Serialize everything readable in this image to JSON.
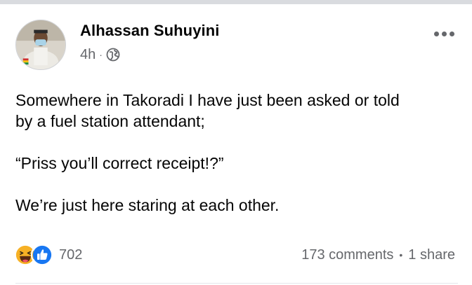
{
  "post": {
    "author": "Alhassan Suhuyini",
    "time": "4h",
    "separator": "·",
    "privacy_icon": "globe-icon",
    "body": {
      "line1": "Somewhere in Takoradi I have just been asked or told",
      "line2": "by a fuel station attendant;",
      "line3": "“Priss you’ll correct receipt!?”",
      "line4": "We’re just here staring at each other."
    }
  },
  "reactions": {
    "icons": [
      "haha-reaction-icon",
      "like-reaction-icon"
    ],
    "count": "702"
  },
  "stats": {
    "comments": "173 comments",
    "separator": "•",
    "shares": "1 share"
  },
  "colors": {
    "text_primary": "#050505",
    "text_secondary": "#65676b",
    "like_blue": "#1877f2",
    "haha_yellow": "#f7b125"
  }
}
